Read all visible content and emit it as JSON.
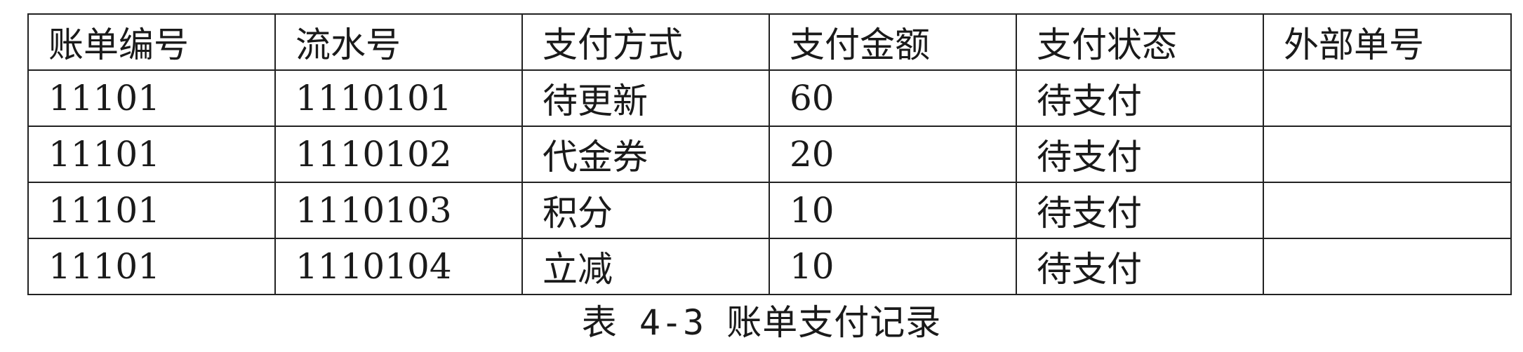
{
  "table": {
    "headers": [
      "账单编号",
      "流水号",
      "支付方式",
      "支付金额",
      "支付状态",
      "外部单号"
    ],
    "rows": [
      [
        "11101",
        "1110101",
        "待更新",
        "60",
        "待支付",
        ""
      ],
      [
        "11101",
        "1110102",
        "代金券",
        "20",
        "待支付",
        ""
      ],
      [
        "11101",
        "1110103",
        "积分",
        "10",
        "待支付",
        ""
      ],
      [
        "11101",
        "1110104",
        "立减",
        "10",
        "待支付",
        ""
      ]
    ]
  },
  "caption": "表 4-3 账单支付记录"
}
